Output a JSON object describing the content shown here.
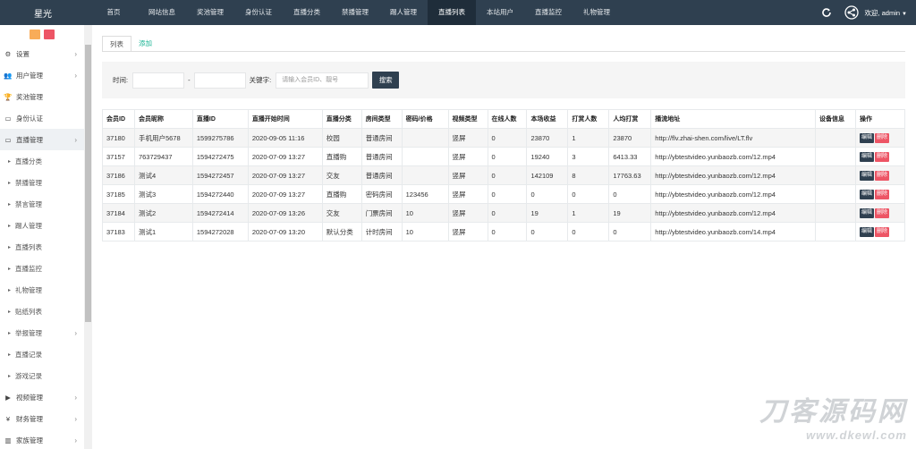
{
  "brand": "星光",
  "nav": [
    "首页",
    "网站信息",
    "奖池管理",
    "身份认证",
    "直播分类",
    "禁播管理",
    "踢人管理",
    "直播列表",
    "本站用户",
    "直播监控",
    "礼物管理"
  ],
  "nav_active_index": 7,
  "user": {
    "greeting": "欢迎, admin"
  },
  "sidebar": {
    "items": [
      {
        "label": "设置",
        "icon": "gears-icon",
        "chevron": true
      },
      {
        "label": "用户管理",
        "icon": "users-icon",
        "chevron": true
      },
      {
        "label": "奖池管理",
        "icon": "trophy-icon",
        "chevron": false
      },
      {
        "label": "身份认证",
        "icon": "id-card-icon",
        "chevron": false
      },
      {
        "label": "直播管理",
        "icon": "monitor-icon",
        "chevron": true,
        "active": true
      },
      {
        "label": "直播分类",
        "sub": true
      },
      {
        "label": "禁播管理",
        "sub": true
      },
      {
        "label": "禁言管理",
        "sub": true
      },
      {
        "label": "踢人管理",
        "sub": true
      },
      {
        "label": "直播列表",
        "sub": true
      },
      {
        "label": "直播监控",
        "sub": true
      },
      {
        "label": "礼物管理",
        "sub": true
      },
      {
        "label": "贴纸列表",
        "sub": true
      },
      {
        "label": "举报管理",
        "sub": true,
        "chevron": true
      },
      {
        "label": "直播记录",
        "sub": true
      },
      {
        "label": "游戏记录",
        "sub": true
      },
      {
        "label": "视频管理",
        "icon": "video-camera-icon",
        "chevron": true
      },
      {
        "label": "财务管理",
        "icon": "yen-icon",
        "chevron": true
      },
      {
        "label": "家族管理",
        "icon": "bank-icon",
        "chevron": true
      }
    ]
  },
  "tabs": [
    {
      "label": "列表"
    },
    {
      "label": "添加"
    }
  ],
  "filter": {
    "time_label": "时间:",
    "range_sep": "-",
    "keyword_label": "关键字:",
    "keyword_placeholder": "请输入会员ID、靓号",
    "search_button": "搜索"
  },
  "table": {
    "headers": [
      "会员ID",
      "会员昵称",
      "直播ID",
      "直播开始时间",
      "直播分类",
      "房间类型",
      "密码/价格",
      "视频类型",
      "在线人数",
      "本场收益",
      "打赏人数",
      "人均打赏",
      "播流地址",
      "设备信息",
      "操作"
    ],
    "rows": [
      [
        "37180",
        "手机用户5678",
        "1599275786",
        "2020-09-05 11:16",
        "校园",
        "普通房间",
        "",
        "竖屏",
        "0",
        "23870",
        "1",
        "23870",
        "http://flv.zhai-shen.com/live/LT.flv",
        ""
      ],
      [
        "37157",
        "763729437",
        "1594272475",
        "2020-07-09 13:27",
        "直播购",
        "普通房间",
        "",
        "竖屏",
        "0",
        "19240",
        "3",
        "6413.33",
        "http://ybtestvideo.yunbaozb.com/12.mp4",
        ""
      ],
      [
        "37186",
        "测试4",
        "1594272457",
        "2020-07-09 13:27",
        "交友",
        "普通房间",
        "",
        "竖屏",
        "0",
        "142109",
        "8",
        "17763.63",
        "http://ybtestvideo.yunbaozb.com/12.mp4",
        ""
      ],
      [
        "37185",
        "测试3",
        "1594272440",
        "2020-07-09 13:27",
        "直播购",
        "密码房间",
        "123456",
        "竖屏",
        "0",
        "0",
        "0",
        "0",
        "http://ybtestvideo.yunbaozb.com/12.mp4",
        ""
      ],
      [
        "37184",
        "测试2",
        "1594272414",
        "2020-07-09 13:26",
        "交友",
        "门票房间",
        "10",
        "竖屏",
        "0",
        "19",
        "1",
        "19",
        "http://ybtestvideo.yunbaozb.com/12.mp4",
        ""
      ],
      [
        "37183",
        "测试1",
        "1594272028",
        "2020-07-09 13:20",
        "默认分类",
        "计时房间",
        "10",
        "竖屏",
        "0",
        "0",
        "0",
        "0",
        "http://ybtestvideo.yunbaozb.com/14.mp4",
        ""
      ]
    ],
    "edit_label": "编辑",
    "delete_label": "删除"
  },
  "watermark": {
    "big": "刀客源码网",
    "small": "www.dkewl.com"
  },
  "colors": {
    "topbar": "#2f4050",
    "accent": "#1ab394",
    "danger": "#ed5565",
    "warning": "#f8ac59"
  }
}
